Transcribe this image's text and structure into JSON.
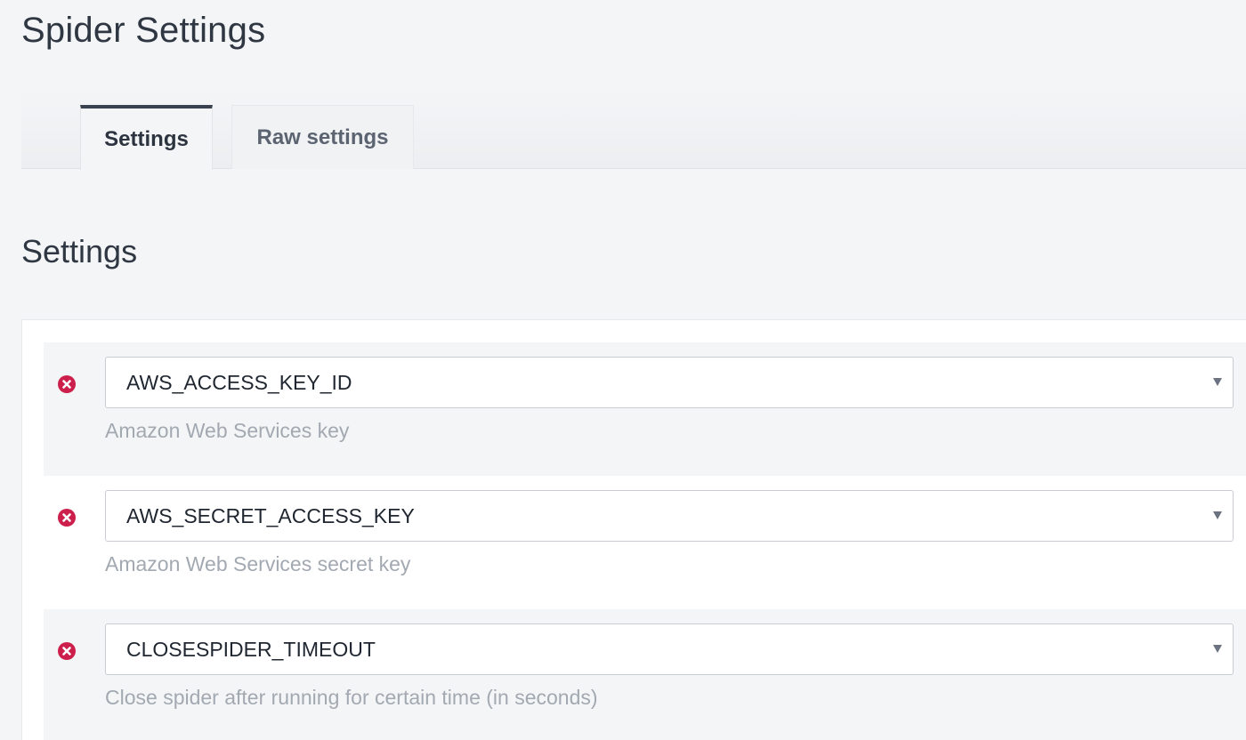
{
  "page": {
    "title": "Spider Settings"
  },
  "tabs": [
    {
      "label": "Settings",
      "active": true
    },
    {
      "label": "Raw settings",
      "active": false
    }
  ],
  "section": {
    "title": "Settings"
  },
  "settings": [
    {
      "key": "AWS_ACCESS_KEY_ID",
      "description": "Amazon Web Services key"
    },
    {
      "key": "AWS_SECRET_ACCESS_KEY",
      "description": "Amazon Web Services secret key"
    },
    {
      "key": "CLOSESPIDER_TIMEOUT",
      "description": "Close spider after running for certain time (in seconds)"
    }
  ],
  "icons": {
    "remove": "remove-circle-icon",
    "dropdown": "caret-down-icon"
  },
  "colors": {
    "remove_icon": "#cc1f4c",
    "description_text": "#a3a9b1",
    "active_tab_border": "#3a4250"
  }
}
